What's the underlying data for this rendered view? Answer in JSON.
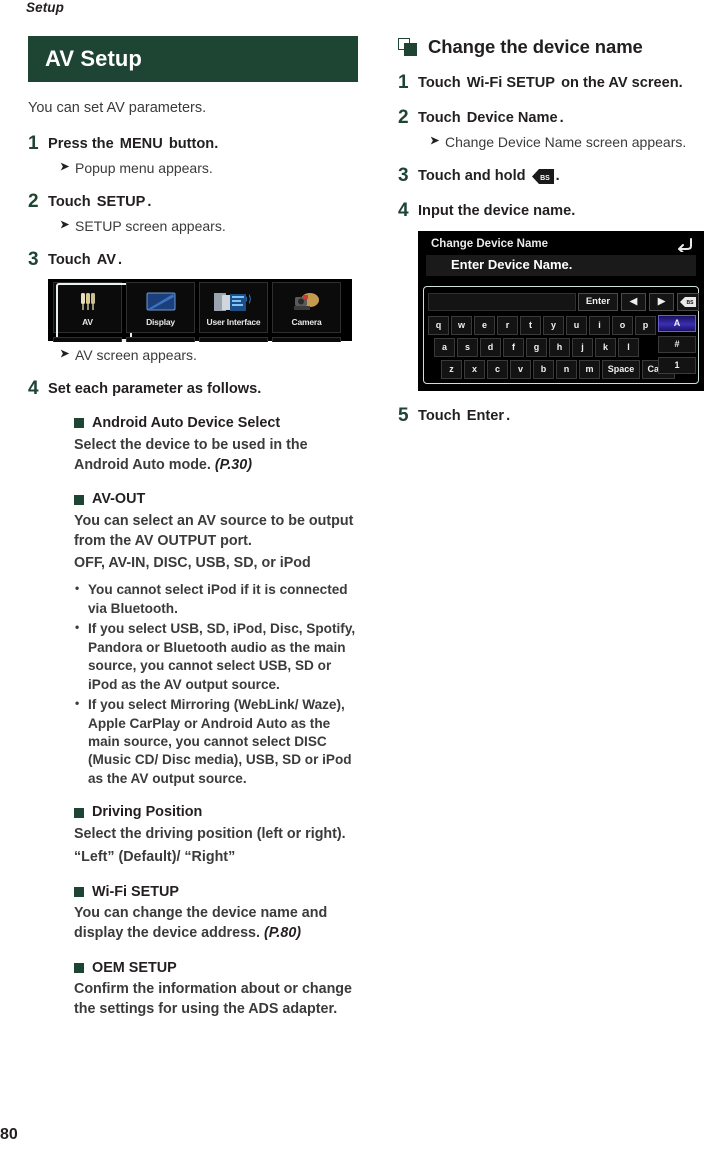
{
  "running_head": "Setup",
  "folio": "80",
  "colors": {
    "brand_green": "#1e4433",
    "body_gray": "#3b3b3b",
    "screen_black": "#000000",
    "key_highlight": "#3a2fb0"
  },
  "left": {
    "section_title": "AV Setup",
    "intro": "You can set AV parameters.",
    "steps": [
      {
        "num": "1",
        "pre": "Press the",
        "kw": "MENU",
        "post": "button.",
        "result": "Popup menu appears."
      },
      {
        "num": "2",
        "pre": "Touch",
        "kw": "SETUP",
        "post": ".",
        "result": "SETUP screen appears."
      },
      {
        "num": "3",
        "pre": "Touch",
        "kw": "AV",
        "post": ".",
        "result": "AV screen appears."
      },
      {
        "num": "4",
        "pre": "Set each parameter as follows.",
        "kw": "",
        "post": "",
        "result": ""
      }
    ],
    "av_screen": {
      "tiles": [
        {
          "label": "AV",
          "icon": "rca-plugs-icon",
          "selected": true
        },
        {
          "label": "Display",
          "icon": "monitor-icon",
          "selected": false
        },
        {
          "label": "User Interface",
          "icon": "windows-sound-icon",
          "selected": false
        },
        {
          "label": "Camera",
          "icon": "camera-icon",
          "selected": false
        }
      ]
    },
    "params": [
      {
        "heading": "Android Auto Device Select",
        "lines": [
          "Select the device to be used in the Android Auto mode."
        ],
        "ref": "(P.30)",
        "extra": [],
        "bullets": []
      },
      {
        "heading": "AV-OUT",
        "lines": [
          "You can select an AV source to be output from the AV OUTPUT port."
        ],
        "ref": "",
        "extra": [
          "OFF, AV-IN, DISC, USB, SD, or iPod"
        ],
        "bullets": [
          "You cannot select iPod if it is connected via Bluetooth.",
          "If you select USB, SD, iPod, Disc, Spotify, Pandora or Bluetooth audio as the main source, you cannot select USB, SD or iPod as the AV output source.",
          "If you select Mirroring (WebLink/ Waze), Apple CarPlay or Android Auto as the main source, you cannot select DISC (Music CD/ Disc media), USB, SD or iPod as the AV output source."
        ]
      },
      {
        "heading": "Driving Position",
        "lines": [
          "Select the driving position (left or right)."
        ],
        "ref": "",
        "extra": [
          "“Left” (Default)/ “Right”"
        ],
        "bullets": []
      },
      {
        "heading": "Wi-Fi SETUP",
        "lines": [
          "You can change the device name and display the device address."
        ],
        "ref": "(P.80)",
        "extra": [],
        "bullets": []
      },
      {
        "heading": "OEM SETUP",
        "lines": [
          "Confirm the information about or change the settings for using the ADS adapter."
        ],
        "ref": "",
        "extra": [],
        "bullets": []
      }
    ]
  },
  "right": {
    "h2_title": "Change the device name",
    "steps": [
      {
        "num": "1",
        "pre": "Touch",
        "kw": "Wi-Fi SETUP",
        "post": "on the AV screen.",
        "result": ""
      },
      {
        "num": "2",
        "pre": "Touch",
        "kw": "Device Name",
        "post": ".",
        "result": "Change Device Name screen appears."
      },
      {
        "num": "3",
        "pre": "Touch and hold",
        "kw": "BS",
        "post": ".",
        "result": ""
      },
      {
        "num": "4",
        "pre": "Input the device name.",
        "kw": "",
        "post": "",
        "result": ""
      },
      {
        "num": "5",
        "pre": "Touch",
        "kw": "Enter",
        "post": ".",
        "result": ""
      }
    ],
    "keyboard_screen": {
      "title": "Change Device Name",
      "field_value": "Enter Device Name.",
      "top_buttons": [
        "Enter",
        "◀",
        "▶",
        "BS"
      ],
      "row1": [
        "q",
        "w",
        "e",
        "r",
        "t",
        "y",
        "u",
        "i",
        "o",
        "p"
      ],
      "row2": [
        "a",
        "s",
        "d",
        "f",
        "g",
        "h",
        "j",
        "k",
        "l"
      ],
      "row3": [
        "z",
        "x",
        "c",
        "v",
        "b",
        "n",
        "m",
        "Space",
        "Caps"
      ],
      "side_keys": [
        "A",
        "#",
        "1"
      ],
      "side_active": "A",
      "return_icon": "return-arrow-icon"
    }
  }
}
